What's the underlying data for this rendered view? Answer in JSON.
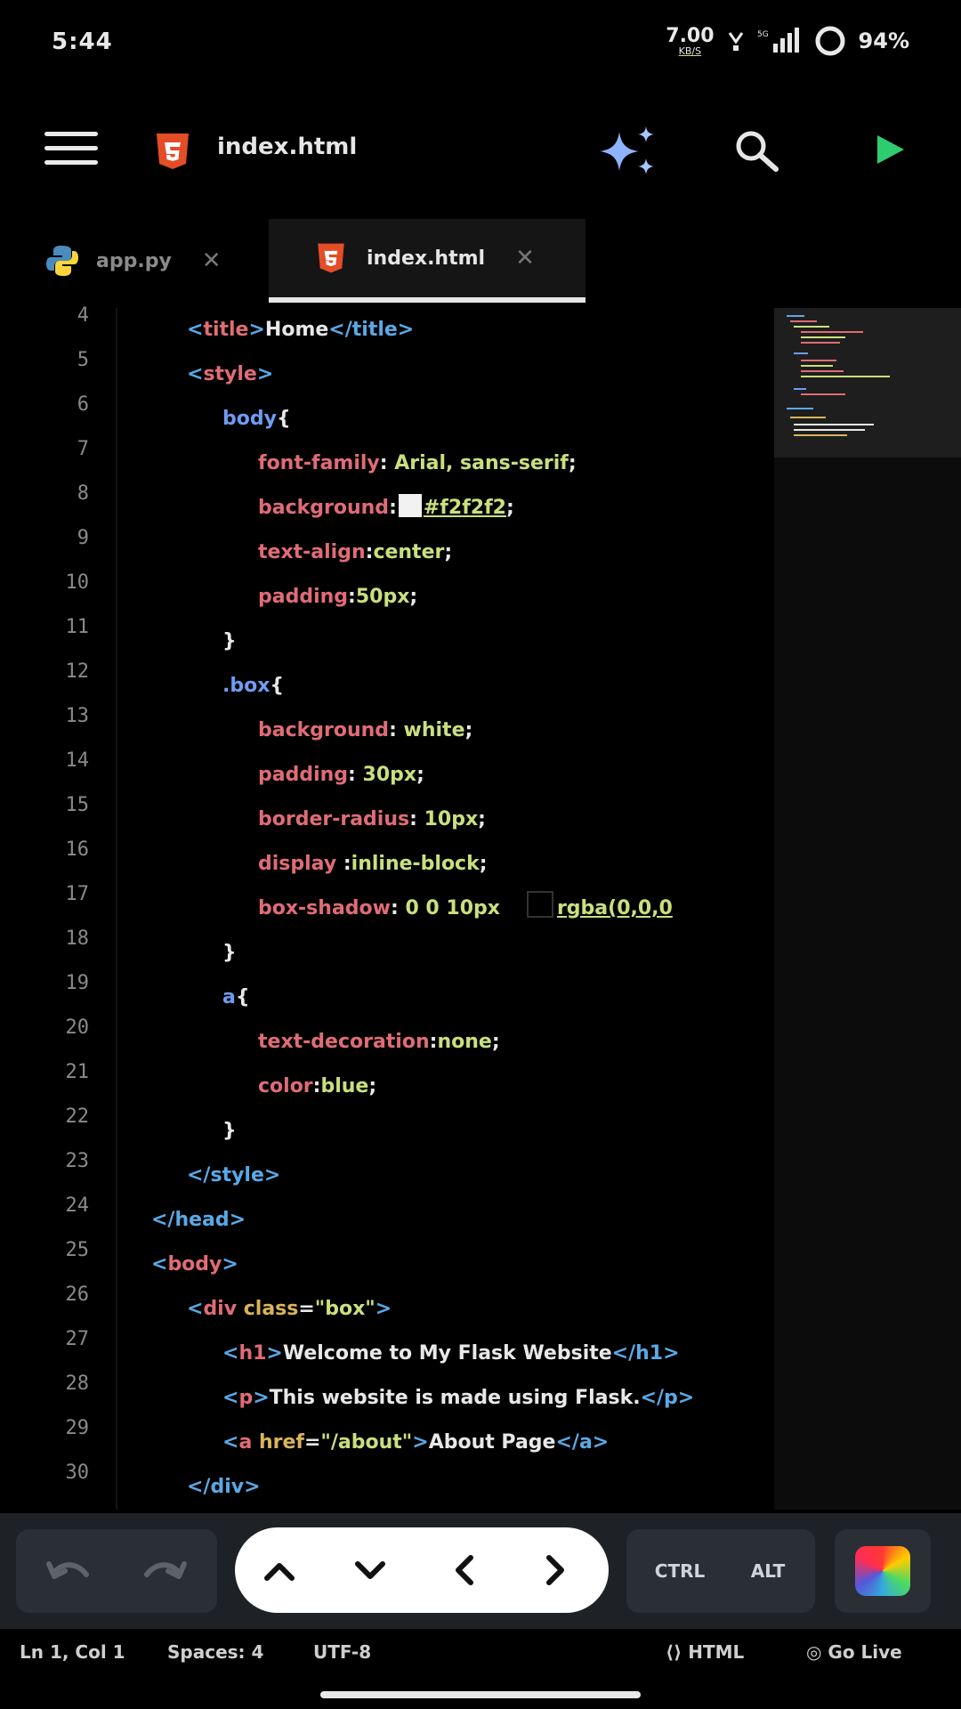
{
  "status_bar": {
    "time": "5:44",
    "net_speed": "7.00",
    "net_unit": "KB/S",
    "battery": "94%"
  },
  "app_bar": {
    "title": "index.html"
  },
  "tabs": [
    {
      "label": "app.py",
      "icon": "python-icon",
      "active": false
    },
    {
      "label": "index.html",
      "icon": "html5-icon",
      "active": true
    }
  ],
  "editor": {
    "line_numbers": [
      "4",
      "5",
      "6",
      "7",
      "8",
      "9",
      "10",
      "11",
      "12",
      "13",
      "14",
      "15",
      "16",
      "17",
      "18",
      "19",
      "20",
      "21",
      "22",
      "23",
      "24",
      "25",
      "26",
      "27",
      "28",
      "29",
      "30"
    ],
    "code": {
      "l4": {
        "open": "<",
        "tag": "title",
        "close": ">",
        "text": "Home",
        "etag": "</title>"
      },
      "l5": {
        "open": "<",
        "tag": "style",
        "close": ">"
      },
      "l6": {
        "sel": "body",
        "brace": "{"
      },
      "l7": {
        "prop": "font-family",
        "colon": ":",
        "val": " Arial, sans-serif",
        "semi": ";"
      },
      "l8": {
        "prop": "background",
        "colon": ":",
        "val": "#f2f2f2",
        "semi": ";"
      },
      "l9": {
        "prop": "text-align",
        "colon": ":",
        "val": "center",
        "semi": ";"
      },
      "l10": {
        "prop": "padding",
        "colon": ":",
        "val": "50px",
        "semi": ";"
      },
      "l11": {
        "brace": "}"
      },
      "l12": {
        "sel": ".box",
        "brace": "{"
      },
      "l13": {
        "prop": "background",
        "colon": ":",
        "val": " white",
        "semi": ";"
      },
      "l14": {
        "prop": "padding",
        "colon": ":",
        "val": " 30px",
        "semi": ";"
      },
      "l15": {
        "prop": "border-radius",
        "colon": ":",
        "val": " 10px",
        "semi": ";"
      },
      "l16": {
        "prop": "display",
        "colon": " :",
        "val": "inline-block",
        "semi": ";"
      },
      "l17": {
        "prop": "box-shadow",
        "colon": ":",
        "val": " 0 0 10px",
        "val2": "rgba(0,0,0"
      },
      "l18": {
        "brace": "}"
      },
      "l19": {
        "sel": "a",
        "brace": "{"
      },
      "l20": {
        "prop": "text-decoration",
        "colon": ":",
        "val": "none",
        "semi": ";"
      },
      "l21": {
        "prop": "color",
        "colon": ":",
        "val": "blue",
        "semi": ";"
      },
      "l22": {
        "brace": "}"
      },
      "l23": {
        "etag": "</style>"
      },
      "l24": {
        "etag": "</head>"
      },
      "l25": {
        "open": "<",
        "tag": "body",
        "close": ">"
      },
      "l26": {
        "open": "<",
        "tag": "div",
        "attr": " class",
        "eq": "=",
        "str": "\"box\"",
        "close": ">"
      },
      "l27": {
        "open": "<",
        "tag": "h1",
        "close": ">",
        "text": "Welcome to My Flask Website",
        "etag": "</h1>"
      },
      "l28": {
        "open": "<",
        "tag": "p",
        "close": ">",
        "text": "This website is made using Flask.",
        "etag": "</p>"
      },
      "l29": {
        "open": "<",
        "tag": "a",
        "attr": " href",
        "eq": "=",
        "str": "\"/about\"",
        "close": ">",
        "text": "About Page",
        "etag": "</a>"
      },
      "l30": {
        "etag": "</div>"
      }
    }
  },
  "toolbar": {
    "ctrl_label": "CTRL",
    "alt_label": "ALT",
    "accent": "#ffffff"
  },
  "bottom_status": {
    "position": "Ln 1, Col 1",
    "spaces": "Spaces: 4",
    "encoding": "UTF-8",
    "language": "HTML",
    "go_live": "Go Live"
  },
  "colors": {
    "background": "#000000",
    "tag": "#e06c75",
    "bracket": "#5aa9e6",
    "value": "#c9e07d",
    "selector": "#6f9cf2",
    "run": "#2ecc71",
    "html5": "#e44d26"
  }
}
